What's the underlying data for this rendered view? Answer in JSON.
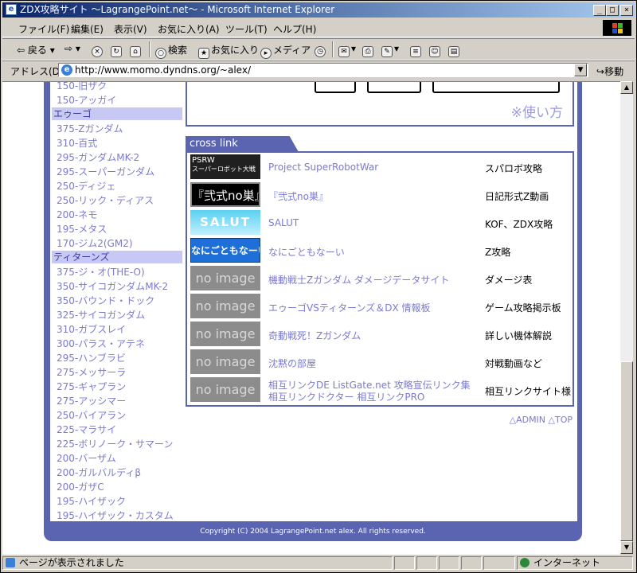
{
  "window": {
    "title": "ZDX攻略サイト ～LagrangePoint.net～ - Microsoft Internet Explorer"
  },
  "menubar": [
    "ファイル(F)",
    "編集(E)",
    "表示(V)",
    "お気に入り(A)",
    "ツール(T)",
    "ヘルプ(H)"
  ],
  "toolbar": {
    "back": "戻る",
    "search": "検索",
    "favorites": "お気に入り",
    "media": "メディア"
  },
  "address": {
    "label": "アドレス(D)",
    "url": "http://www.momo.dyndns.org/~alex/",
    "go": "移動"
  },
  "sidebar": {
    "items_top": [
      "150-旧ザク",
      "150-アッガイ"
    ],
    "aeug_header": "エゥーゴ",
    "aeug": [
      "375-Zガンダム",
      "310-百式",
      "295-ガンダムMK-2",
      "295-スーパーガンダム",
      "250-ディジェ",
      "250-リック・ディアス",
      "200-ネモ",
      "195-メタス",
      "170-ジム2(GM2)"
    ],
    "titans_header": "ティターンズ",
    "titans": [
      "375-ジ・オ(THE-O)",
      "350-サイコガンダムMK-2",
      "350-バウンド・ドック",
      "325-サイコガンダム",
      "310-ガブスレイ",
      "300-パラス・アテネ",
      "295-ハンブラビ",
      "275-メッサーラ",
      "275-ギャプラン",
      "275-アッシマー",
      "250-バイアラン",
      "225-マラサイ",
      "225-ボリノーク・サマーン",
      "200-バーザム",
      "200-ガルバルディβ",
      "200-ガザC",
      "195-ハイザック",
      "195-ハイザック・カスタム"
    ]
  },
  "main": {
    "howto": "※使い方",
    "crosslink_title": "cross link",
    "links": [
      {
        "banner": "psrw",
        "banner_text": "PSRW",
        "banner_sub": "スーパーロボット大戦",
        "title": "Project SuperRobotWar",
        "desc": "スパロボ攻略"
      },
      {
        "banner": "shiki",
        "banner_text": "『弐式no巣』",
        "title": "『弐式no巣』",
        "desc": "日記形式Z動画"
      },
      {
        "banner": "salut",
        "banner_text": "SALUT",
        "title": "SALUT",
        "desc": "KOF、ZDX攻略"
      },
      {
        "banner": "nani",
        "banner_text": "なにごともなーい",
        "title": "なにごともなーい",
        "desc": "Z攻略"
      },
      {
        "banner": "noimg",
        "banner_text": "no image",
        "title": "機動戦士Zガンダム ダメージデータサイト",
        "desc": "ダメージ表"
      },
      {
        "banner": "noimg",
        "banner_text": "no image",
        "title": "エゥーゴVSティターンズ＆DX 情報板",
        "desc": "ゲーム攻略掲示板"
      },
      {
        "banner": "noimg",
        "banner_text": "no image",
        "title": "奇動戦死！Zガンダム",
        "desc": "詳しい機体解説"
      },
      {
        "banner": "noimg",
        "banner_text": "no image",
        "title": "沈黙の部屋",
        "desc": "対戦動画など"
      },
      {
        "banner": "noimg",
        "banner_text": "no image",
        "title": "相互リンクDE ListGate.net 攻略宣伝リンク集",
        "title2": "相互リンクドクター 相互リンクPRO",
        "desc": "相互リンクサイト様"
      }
    ],
    "admin": "△ADMIN △TOP",
    "copyright": "Copyright (C) 2004 LagrangePoint.net alex. All rights reserved."
  },
  "status": {
    "text": "ページが表示されました",
    "zone": "インターネット"
  }
}
